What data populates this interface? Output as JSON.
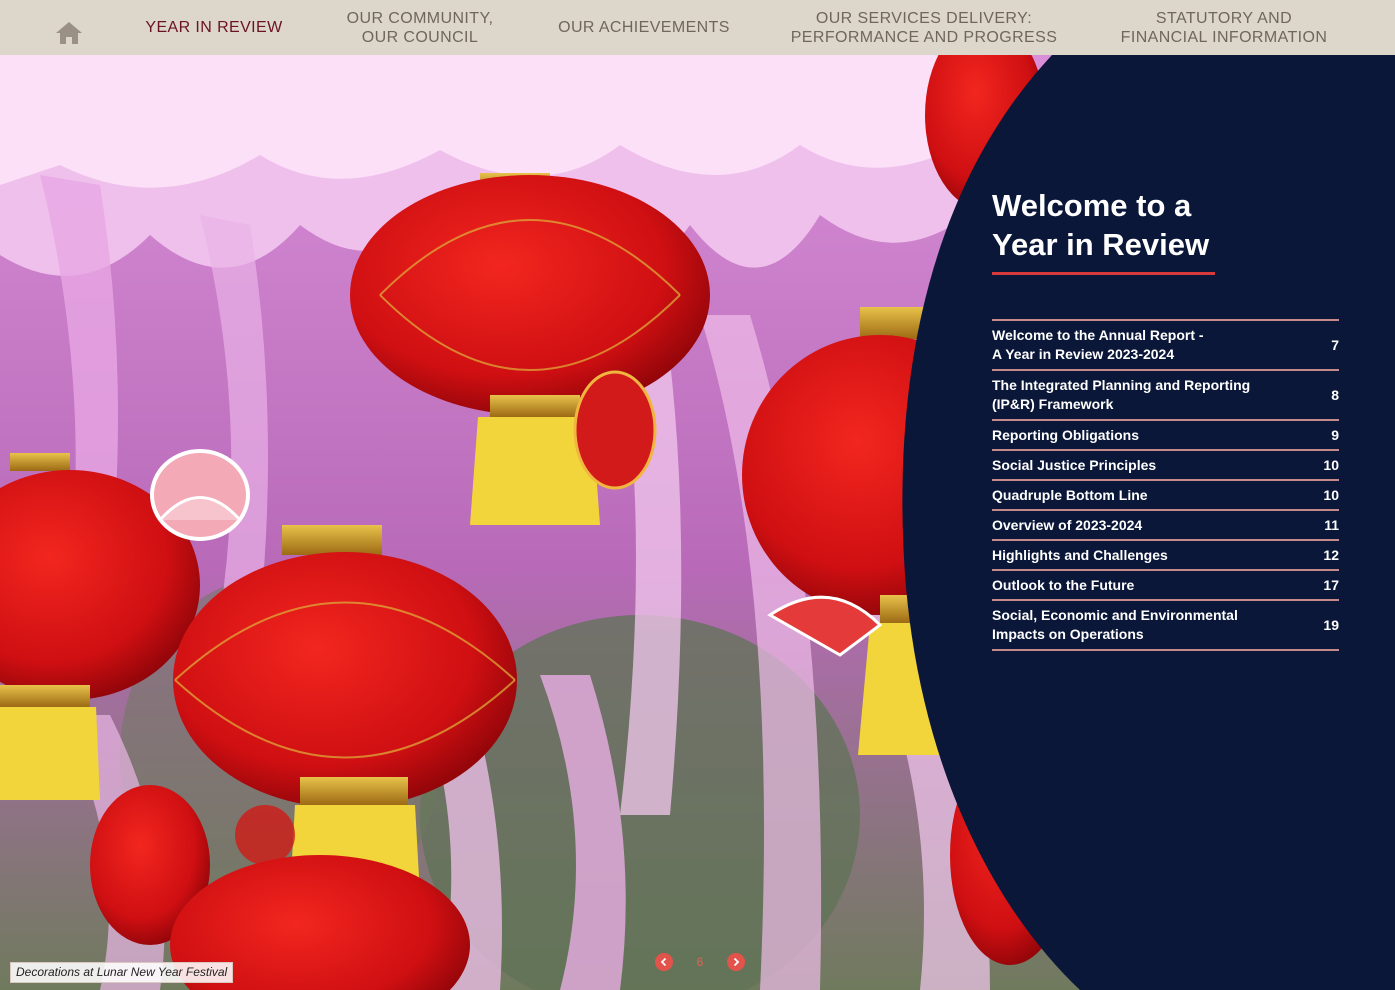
{
  "nav": {
    "home_icon": "home-icon",
    "items": [
      {
        "line1": "YEAR IN REVIEW",
        "line2": "",
        "active": true
      },
      {
        "line1": "OUR COMMUNITY,",
        "line2": "OUR COUNCIL",
        "active": false
      },
      {
        "line1": "OUR ACHIEVEMENTS",
        "line2": "",
        "active": false
      },
      {
        "line1": "OUR SERVICES DELIVERY:",
        "line2": "PERFORMANCE AND PROGRESS",
        "active": false
      },
      {
        "line1": "STATUTORY AND",
        "line2": "FINANCIAL INFORMATION",
        "active": false
      }
    ]
  },
  "panel": {
    "title_line1": "Welcome to a",
    "title_line2": "Year in Review",
    "toc": [
      {
        "line1": "Welcome to the Annual Report -",
        "line2": "A Year in Review 2023-2024",
        "page": "7"
      },
      {
        "line1": "The Integrated Planning and Reporting",
        "line2": "(IP&R) Framework",
        "page": "8"
      },
      {
        "line1": "Reporting Obligations",
        "line2": "",
        "page": "9"
      },
      {
        "line1": "Social Justice Principles",
        "line2": "",
        "page": "10"
      },
      {
        "line1": "Quadruple Bottom Line",
        "line2": "",
        "page": "10"
      },
      {
        "line1": "Overview of 2023-2024",
        "line2": "",
        "page": "11"
      },
      {
        "line1": "Highlights and Challenges",
        "line2": "",
        "page": "12"
      },
      {
        "line1": "Outlook to the Future",
        "line2": "",
        "page": "17"
      },
      {
        "line1": "Social, Economic and Environmental",
        "line2": "Impacts on Operations",
        "page": "19"
      }
    ]
  },
  "caption": "Decorations at Lunar New Year Festival",
  "pager": {
    "current_page": "6",
    "prev_icon": "chevron-left-icon",
    "next_icon": "chevron-right-icon"
  },
  "colors": {
    "nav_bg": "#dcd6cb",
    "nav_text": "#6f675d",
    "nav_active": "#6b1421",
    "panel_bg": "#0b1738",
    "accent_red": "#d63a3a",
    "rule": "#c58a8a",
    "pager": "#e2534b"
  }
}
